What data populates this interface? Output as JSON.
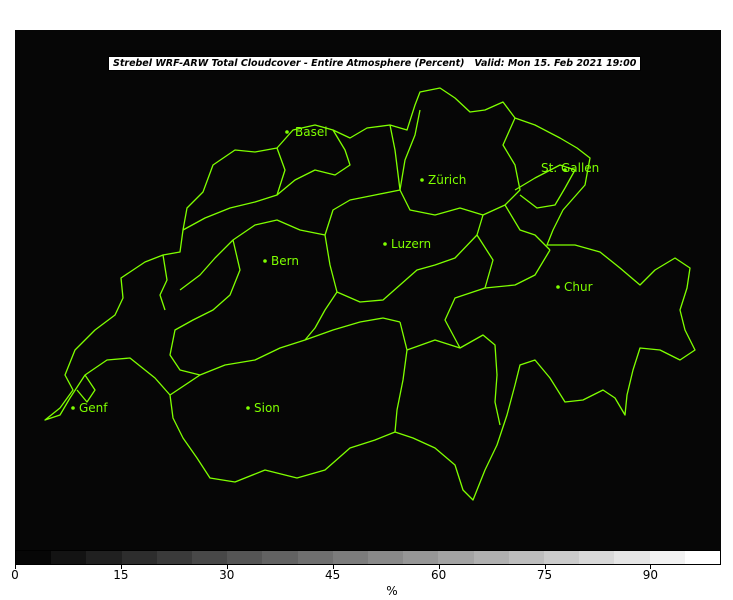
{
  "title": "Strebel WRF-ARW Total Cloudcover - Entire Atmosphere (Percent)   Valid: Mon 15. Feb 2021 19:00",
  "cities": [
    {
      "name": "Basel"
    },
    {
      "name": "Zürich"
    },
    {
      "name": "St. Gallen"
    },
    {
      "name": "Luzern"
    },
    {
      "name": "Bern"
    },
    {
      "name": "Chur"
    },
    {
      "name": "Genf"
    },
    {
      "name": "Sion"
    }
  ],
  "colorbar": {
    "min": 0,
    "max": 100,
    "steps": 20,
    "ticks": [
      "0",
      "15",
      "30",
      "45",
      "60",
      "75",
      "90"
    ],
    "unit": "%",
    "start_color": "#060606",
    "end_color": "#ffffff"
  },
  "colors": {
    "background": "#060606",
    "border": "#7fff00"
  }
}
